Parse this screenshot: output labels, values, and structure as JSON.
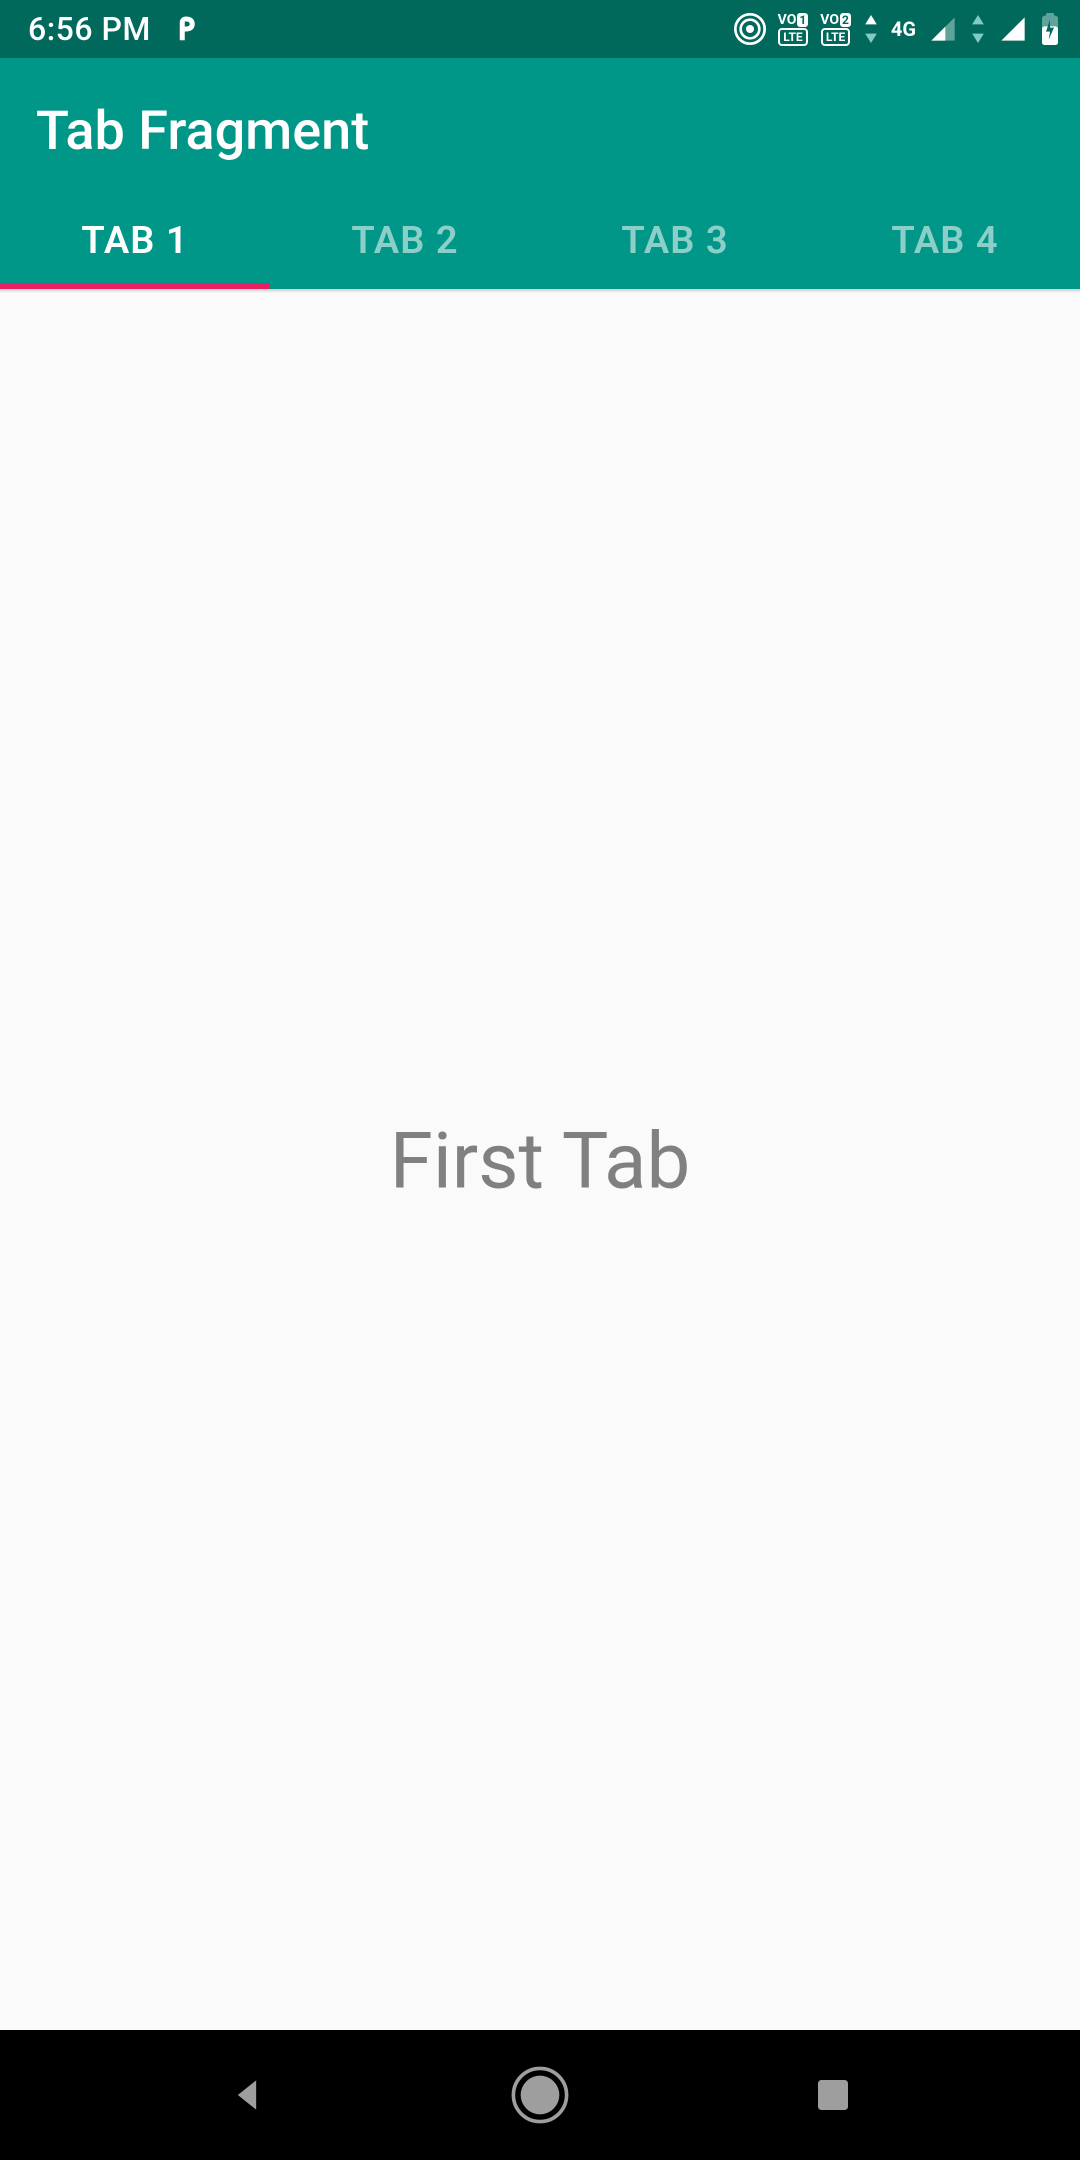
{
  "status": {
    "time": "6:56 PM",
    "icons": {
      "app": "p-icon",
      "hotspot": "hotspot-icon",
      "volte1": {
        "vo": "VO",
        "num": "1",
        "lte": "LTE"
      },
      "volte2": {
        "vo": "VO",
        "num": "2",
        "lte": "LTE"
      },
      "network": "4G",
      "signal1": "signal-icon",
      "signal2": "signal-icon",
      "battery": "battery-charging-icon"
    }
  },
  "appbar": {
    "title": "Tab Fragment"
  },
  "tabs": {
    "items": [
      {
        "label": "TAB 1"
      },
      {
        "label": "TAB 2"
      },
      {
        "label": "TAB 3"
      },
      {
        "label": "TAB 4"
      }
    ],
    "active_index": 0
  },
  "content": {
    "text": "First Tab"
  },
  "nav": {
    "back": "back-icon",
    "home": "home-icon",
    "recent": "recent-icon"
  },
  "colors": {
    "primary": "#009688",
    "primary_dark": "#00695c",
    "accent": "#e91e63",
    "text_secondary": "#808080",
    "background": "#fafafa"
  }
}
